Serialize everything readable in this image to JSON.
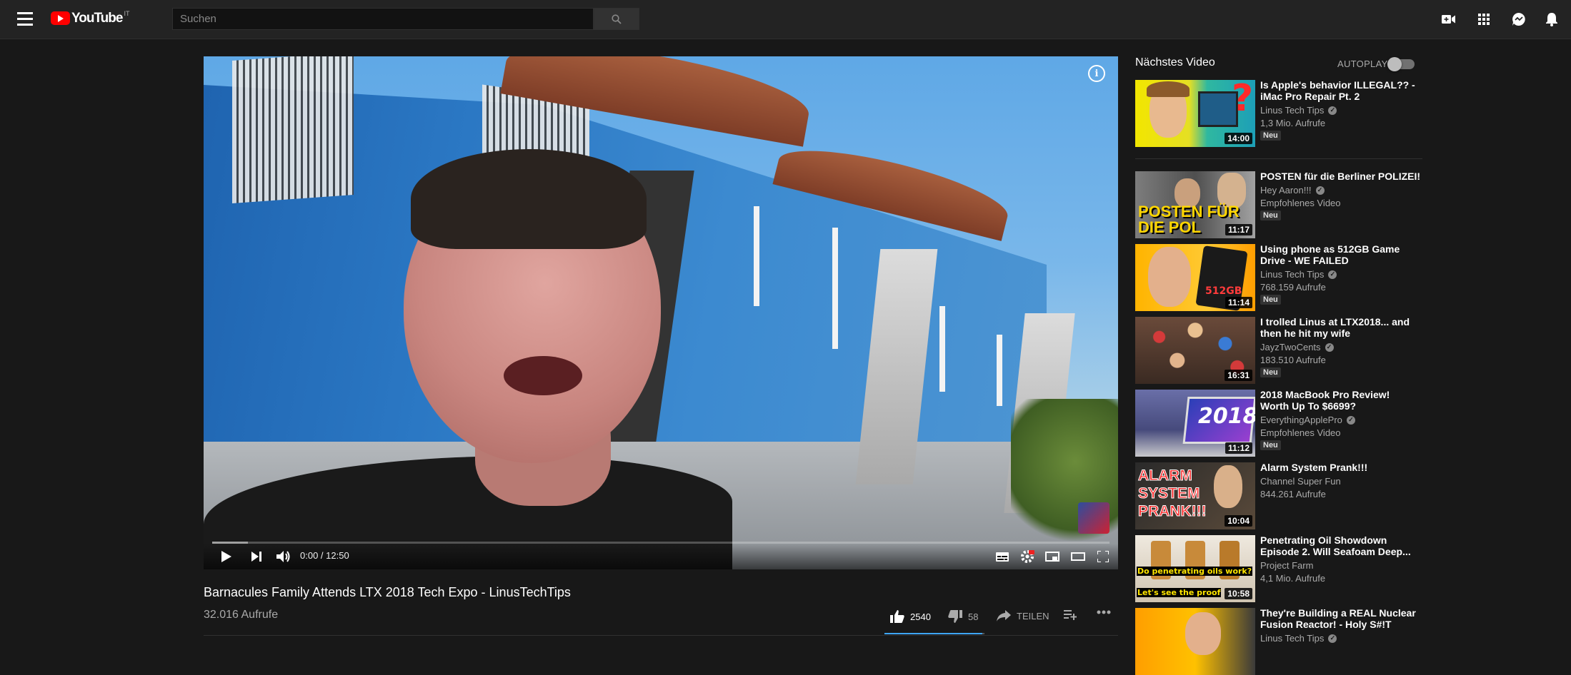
{
  "header": {
    "logo_text": "YouTube",
    "logo_region": "IT",
    "search_placeholder": "Suchen"
  },
  "player": {
    "time": "0:00 / 12:50",
    "progress_loaded_fraction": 0.04
  },
  "video": {
    "title": "Barnacules Family Attends LTX 2018 Tech Expo - LinusTechTips",
    "views": "32.016 Aufrufe",
    "likes": "2540",
    "dislikes": "58",
    "share_label": "TEILEN",
    "like_ratio": 0.978
  },
  "sidebar": {
    "up_next_label": "Nächstes Video",
    "autoplay_label": "AUTOPLAY",
    "autoplay_on": false,
    "items": [
      {
        "title": "Is Apple's behavior ILLEGAL?? - iMac Pro Repair Pt. 2",
        "channel": "Linus Tech Tips",
        "verified": true,
        "views": "1,3 Mio. Aufrufe",
        "badge": "Neu",
        "duration": "14:00"
      },
      {
        "title": "POSTEN für die Berliner POLIZEI!",
        "channel": "Hey Aaron!!!",
        "verified": true,
        "views": "Empfohlenes Video",
        "badge": "Neu",
        "duration": "11:17",
        "thumb_text": "POSTEN FÜR DIE POL"
      },
      {
        "title": "Using phone as 512GB Game Drive - WE FAILED",
        "channel": "Linus Tech Tips",
        "verified": true,
        "views": "768.159 Aufrufe",
        "badge": "Neu",
        "duration": "11:14",
        "thumb_text": "512GB"
      },
      {
        "title": "I trolled Linus at LTX2018... and then he hit my wife",
        "channel": "JayzTwoCents",
        "verified": true,
        "views": "183.510 Aufrufe",
        "badge": "Neu",
        "duration": "16:31"
      },
      {
        "title": "2018 MacBook Pro Review! Worth Up To $6699?",
        "channel": "EverythingApplePro",
        "verified": true,
        "views": "Empfohlenes Video",
        "badge": "Neu",
        "duration": "11:12",
        "thumb_text": "2018"
      },
      {
        "title": "Alarm System Prank!!!",
        "channel": "Channel Super Fun",
        "verified": false,
        "views": "844.261 Aufrufe",
        "badge": "",
        "duration": "10:04",
        "thumb_text": "ALARM SYSTEM PRANK!!!"
      },
      {
        "title": "Penetrating Oil Showdown Episode 2. Will Seafoam Deep...",
        "channel": "Project Farm",
        "verified": false,
        "views": "4,1 Mio. Aufrufe",
        "badge": "",
        "duration": "10:58",
        "thumb_text_1": "Do penetrating oils work?",
        "thumb_text_2": "Let's see the proof"
      },
      {
        "title": "They're Building a REAL Nuclear Fusion Reactor! - Holy S#!T",
        "channel": "Linus Tech Tips",
        "verified": true,
        "views": "",
        "badge": "",
        "duration": ""
      }
    ]
  }
}
